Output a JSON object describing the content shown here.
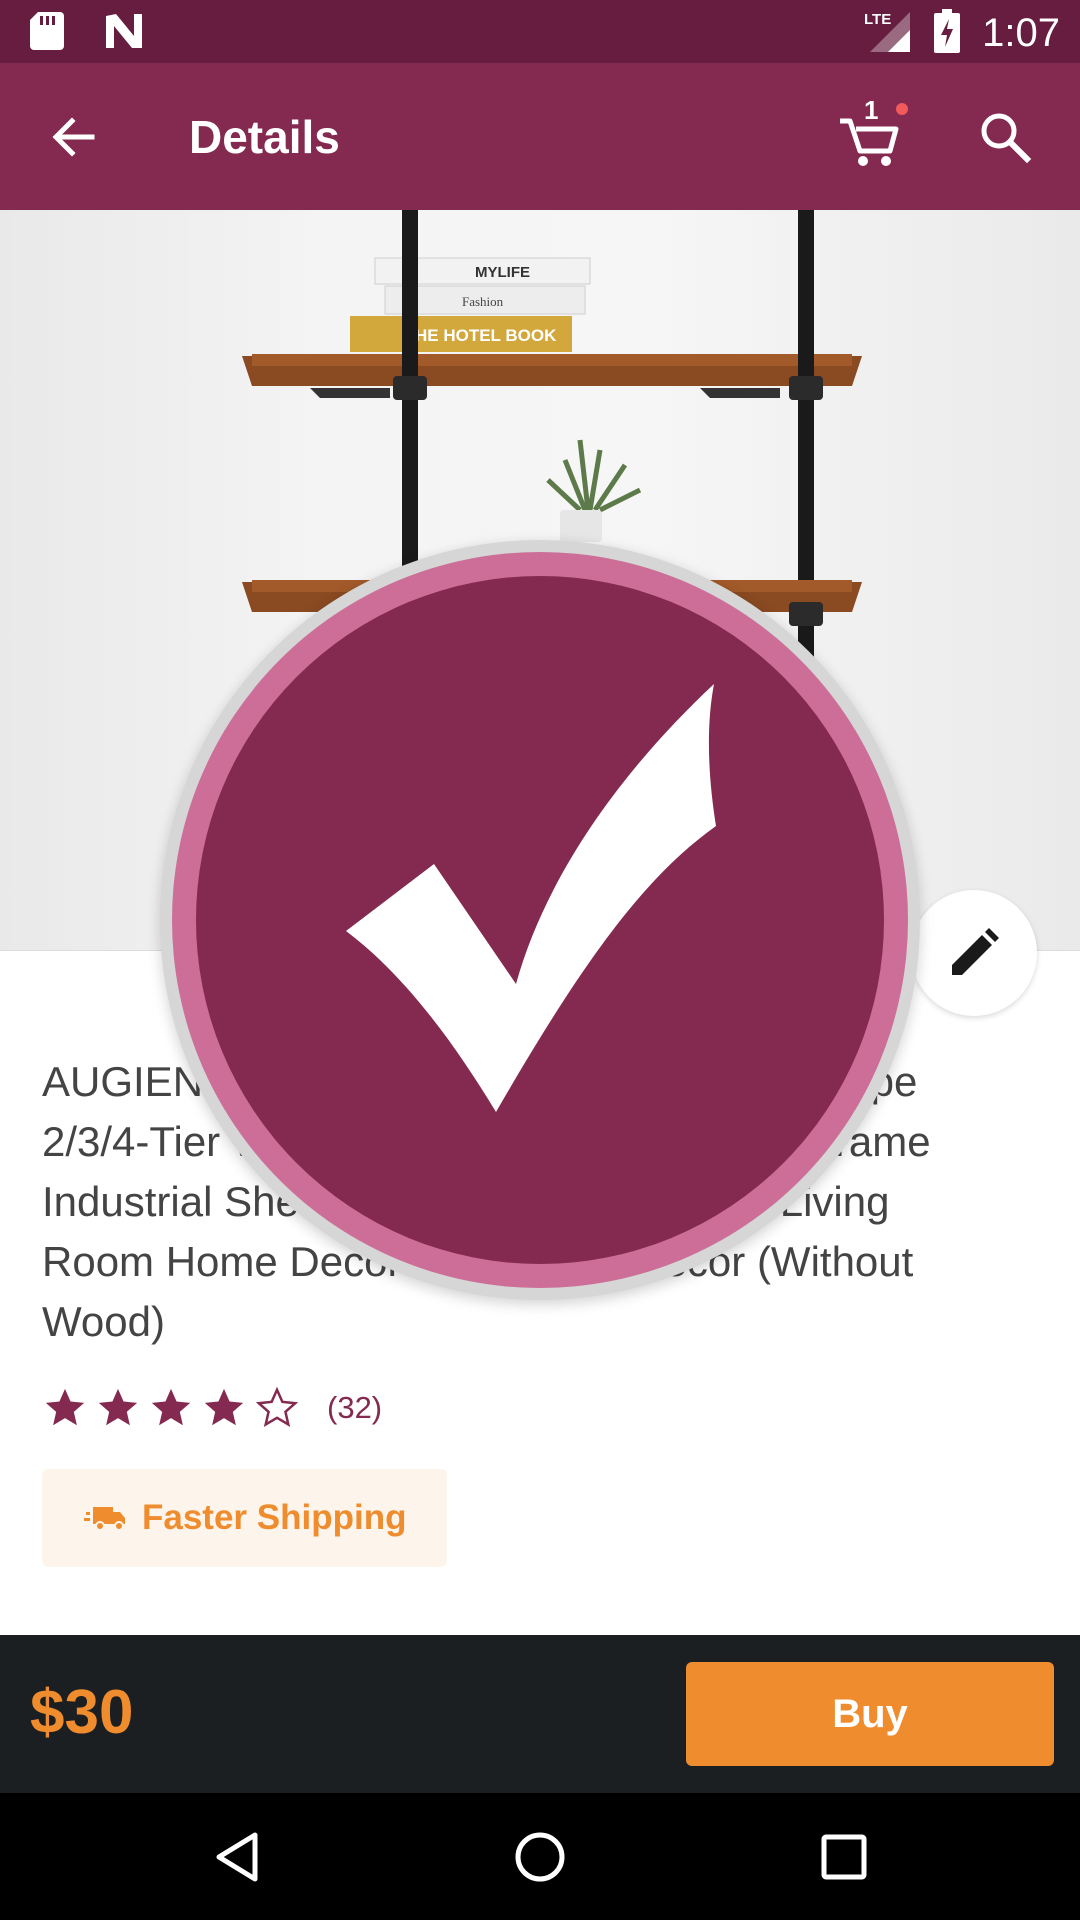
{
  "status_bar": {
    "time": "1:07",
    "network": "LTE",
    "icons": [
      "sd-card-icon",
      "n-logo-icon",
      "signal-icon",
      "battery-charging-icon"
    ]
  },
  "app_bar": {
    "title": "Details",
    "cart_count": "1"
  },
  "product_image": {
    "book_labels": [
      "MYLIFE",
      "Fashion",
      "HE HOTEL BOOK"
    ]
  },
  "product": {
    "title": "AUGIENB Industrial Floating Shelves with Pipe 2/3/4-Tier Wall Mounted Bookshelf Metal Frame Industrial Shelves for Kitchen Bedroom Living Room Home Decor Rustic Wall Decor (Without Wood)",
    "rating_value": 4,
    "rating_max": 5,
    "review_count": "(32)",
    "shipping_label": "Faster Shipping"
  },
  "purchase": {
    "price": "$30",
    "buy_label": "Buy"
  },
  "colors": {
    "status_bar": "#661d40",
    "primary": "#84294f",
    "accent": "#ee8c2e",
    "bottom_bar": "#1c1f21"
  }
}
